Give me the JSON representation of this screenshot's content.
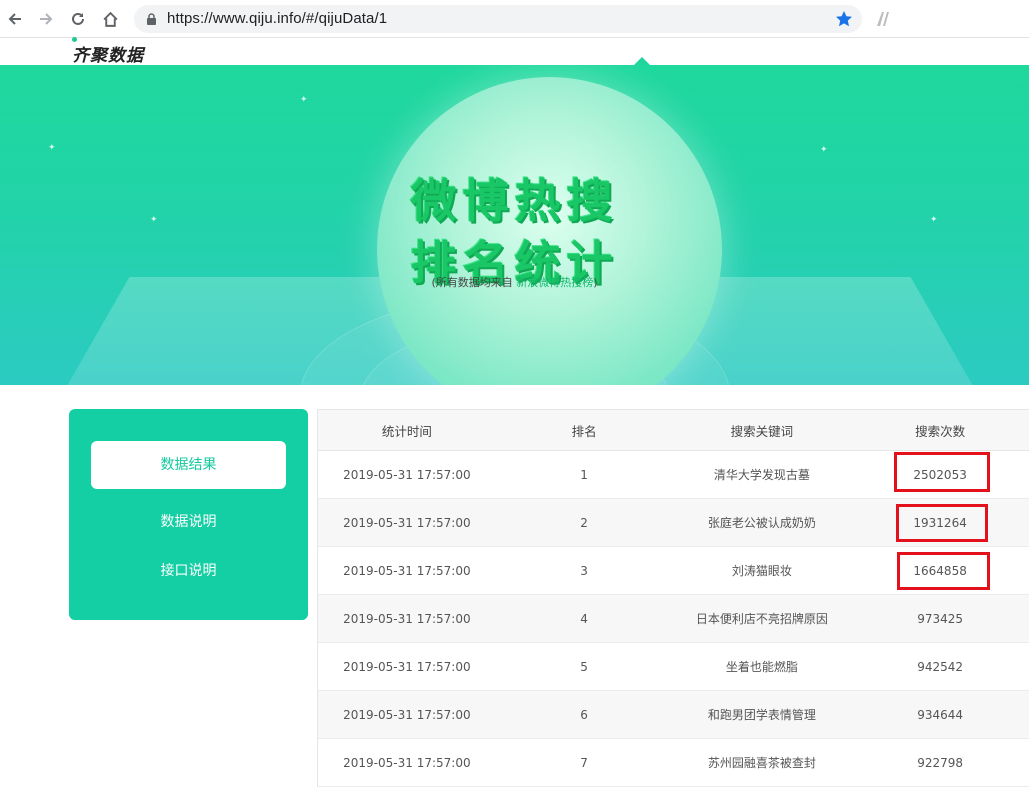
{
  "browser": {
    "url": "https://www.qiju.info/#/qijuData/1"
  },
  "header": {
    "logo_text": "齐聚数据"
  },
  "banner": {
    "title_line1": "微博热搜",
    "title_line2": "排名统计",
    "subtitle_prefix": "(所有数据均来自",
    "subtitle_source": "新浪微博热搜榜",
    "subtitle_suffix": ")"
  },
  "sidebar": {
    "items": [
      {
        "label": "数据结果",
        "active": true
      },
      {
        "label": "数据说明",
        "active": false
      },
      {
        "label": "接口说明",
        "active": false
      }
    ]
  },
  "table": {
    "headers": [
      "统计时间",
      "排名",
      "搜索关键词",
      "搜索次数"
    ],
    "rows": [
      [
        "2019-05-31 17:57:00",
        "1",
        "清华大学发现古墓",
        "2502053"
      ],
      [
        "2019-05-31 17:57:00",
        "2",
        "张庭老公被认成奶奶",
        "1931264"
      ],
      [
        "2019-05-31 17:57:00",
        "3",
        "刘涛猫眼妆",
        "1664858"
      ],
      [
        "2019-05-31 17:57:00",
        "4",
        "日本便利店不亮招牌原因",
        "973425"
      ],
      [
        "2019-05-31 17:57:00",
        "5",
        "坐着也能燃脂",
        "942542"
      ],
      [
        "2019-05-31 17:57:00",
        "6",
        "和跑男团学表情管理",
        "934644"
      ],
      [
        "2019-05-31 17:57:00",
        "7",
        "苏州园融喜茶被查封",
        "922798"
      ]
    ]
  },
  "colors": {
    "accent": "#14cfa3",
    "highlight_box": "#e3111b",
    "title_green": "#19c766"
  }
}
